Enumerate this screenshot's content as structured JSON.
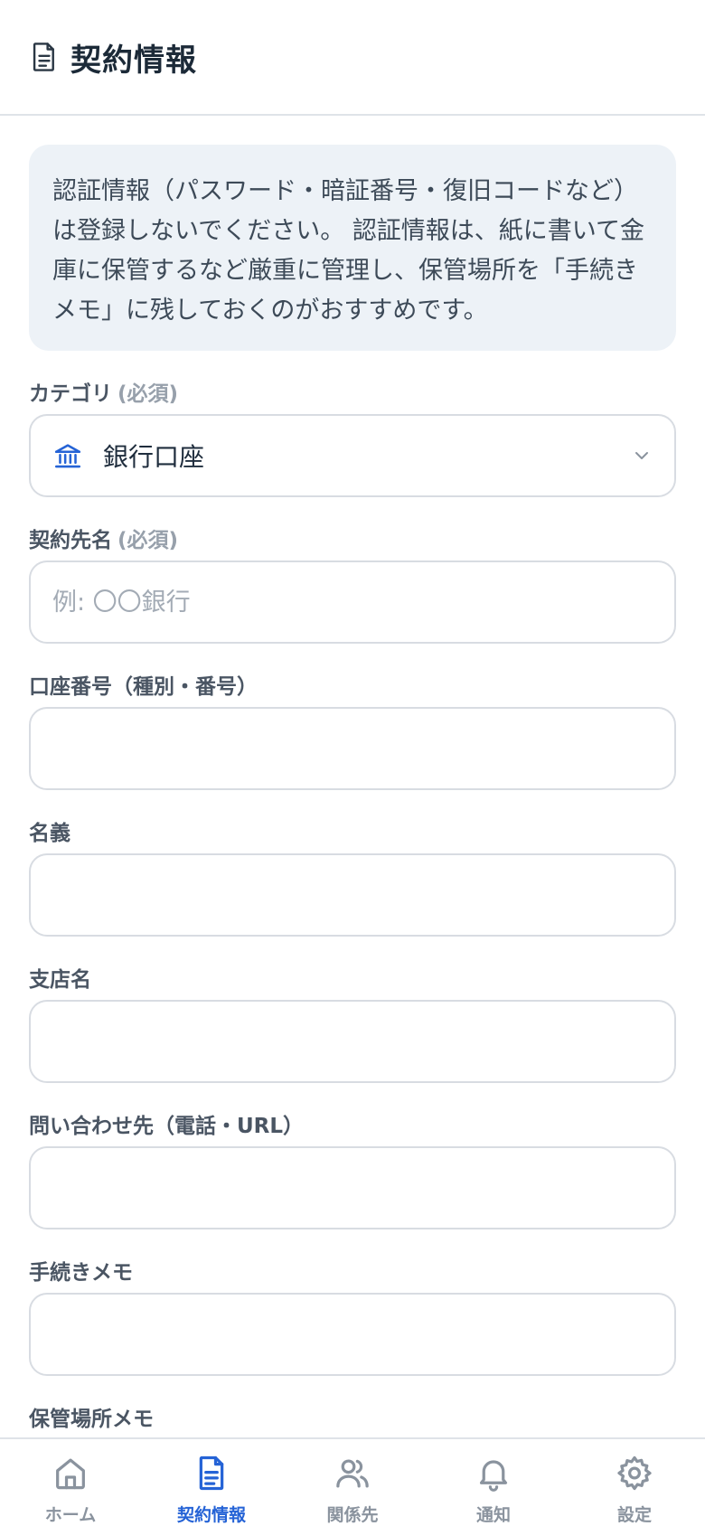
{
  "header": {
    "title": "契約情報",
    "icon": "document-icon"
  },
  "notice": {
    "text": "認証情報（パスワード・暗証番号・復旧コードなど）は登録しないでください。 認証情報は、紙に書いて金庫に保管するなど厳重に管理し、保管場所を「手続きメモ」に残しておくのがおすすめです。"
  },
  "form": {
    "category": {
      "label": "カテゴリ",
      "required": "(必須)",
      "value": "銀行口座",
      "icon": "bank-icon"
    },
    "contract_name": {
      "label": "契約先名",
      "required": "(必須)",
      "placeholder": "例: 〇〇銀行",
      "value": ""
    },
    "account_number": {
      "label": "口座番号（種別・番号）",
      "value": ""
    },
    "holder": {
      "label": "名義",
      "value": ""
    },
    "branch": {
      "label": "支店名",
      "value": ""
    },
    "contact": {
      "label": "問い合わせ先（電話・URL）",
      "value": ""
    },
    "procedure_memo": {
      "label": "手続きメモ",
      "value": ""
    },
    "storage_memo": {
      "label": "保管場所メモ"
    }
  },
  "nav": {
    "active": "contracts",
    "items": [
      {
        "id": "home",
        "label": "ホーム",
        "icon": "home-icon"
      },
      {
        "id": "contracts",
        "label": "契約情報",
        "icon": "document-icon"
      },
      {
        "id": "contacts",
        "label": "関係先",
        "icon": "users-icon"
      },
      {
        "id": "notifications",
        "label": "通知",
        "icon": "bell-icon"
      },
      {
        "id": "settings",
        "label": "設定",
        "icon": "gear-icon"
      }
    ]
  },
  "colors": {
    "accent": "#2563d6",
    "inactive": "#8a939e",
    "notice_bg": "#edf2f7"
  }
}
